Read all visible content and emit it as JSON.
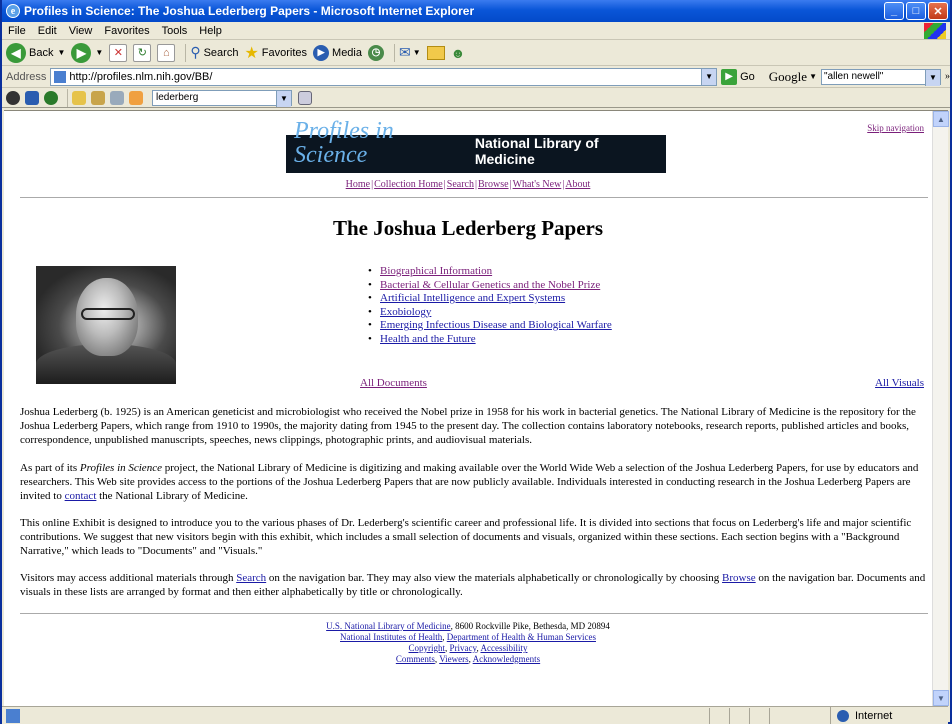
{
  "window": {
    "title": "Profiles in Science: The Joshua Lederberg Papers - Microsoft Internet Explorer"
  },
  "menu": [
    "File",
    "Edit",
    "View",
    "Favorites",
    "Tools",
    "Help"
  ],
  "toolbar": {
    "back": "Back",
    "search": "Search",
    "favorites": "Favorites",
    "media": "Media"
  },
  "address": {
    "label": "Address",
    "url": "http://profiles.nlm.nih.gov/BB/",
    "go": "Go"
  },
  "google": {
    "label": "Google",
    "query": "\"allen newell\""
  },
  "toolbar2": {
    "query": "lederberg"
  },
  "page": {
    "skip_nav": "Skip navigation",
    "banner_italic": "Profiles in Science",
    "banner_bold": "National Library of Medicine",
    "nav": [
      "Home",
      "Collection Home",
      "Search",
      "Browse",
      "What's New",
      "About"
    ],
    "heading": "The Joshua Lederberg Papers",
    "topics": [
      "Biographical Information",
      "Bacterial & Cellular Genetics and the Nobel Prize",
      "Artificial Intelligence and Expert Systems",
      "Exobiology",
      "Emerging Infectious Disease and Biological Warfare",
      "Health and the Future"
    ],
    "all_documents": "All Documents",
    "all_visuals": "All Visuals",
    "p1": "Joshua Lederberg (b. 1925) is an American geneticist and microbiologist who received the Nobel prize in 1958 for his work in bacterial genetics. The National Library of Medicine is the repository for the Joshua Lederberg Papers, which range from 1910 to 1990s, the majority dating from 1945 to the present day. The collection contains laboratory notebooks, research reports, published articles and books, correspondence, unpublished manuscripts, speeches, news clippings, photographic prints, and audiovisual materials.",
    "p2_a": "As part of its ",
    "p2_italic": "Profiles in Science",
    "p2_b": " project, the National Library of Medicine is digitizing and making available over the World Wide Web a selection of the Joshua Lederberg Papers, for use by educators and researchers. This Web site provides access to the portions of the Joshua Lederberg Papers that are now publicly available. Individuals interested in conducting research in the Joshua Lederberg Papers are invited to ",
    "p2_link": "contact",
    "p2_c": " the National Library of Medicine.",
    "p3": "This online Exhibit is designed to introduce you to the various phases of Dr. Lederberg's scientific career and professional life. It is divided into sections that focus on Lederberg's life and major scientific contributions. We suggest that new visitors begin with this exhibit, which includes a small selection of documents and visuals, organized within these sections. Each section begins with a \"Background Narrative,\" which leads to \"Documents\" and \"Visuals.\"",
    "p4_a": "Visitors may access additional materials through ",
    "p4_link1": "Search",
    "p4_b": " on the navigation bar. They may also view the materials alphabetically or chronologically by choosing ",
    "p4_link2": "Browse",
    "p4_c": " on the navigation bar. Documents and visuals in these lists are arranged by format and then either alphabetically by title or chronologically.",
    "footer": {
      "nlm": "U.S. National Library of Medicine",
      "address": ", 8600 Rockville Pike, Bethesda, MD 20894",
      "nih": "National Institutes of Health",
      "hhs": "Department of Health & Human Services",
      "copyright": "Copyright",
      "privacy": "Privacy",
      "accessibility": "Accessibility",
      "comments": "Comments",
      "viewers": "Viewers",
      "acknowledgments": "Acknowledgments"
    }
  },
  "status": {
    "zone": "Internet"
  }
}
